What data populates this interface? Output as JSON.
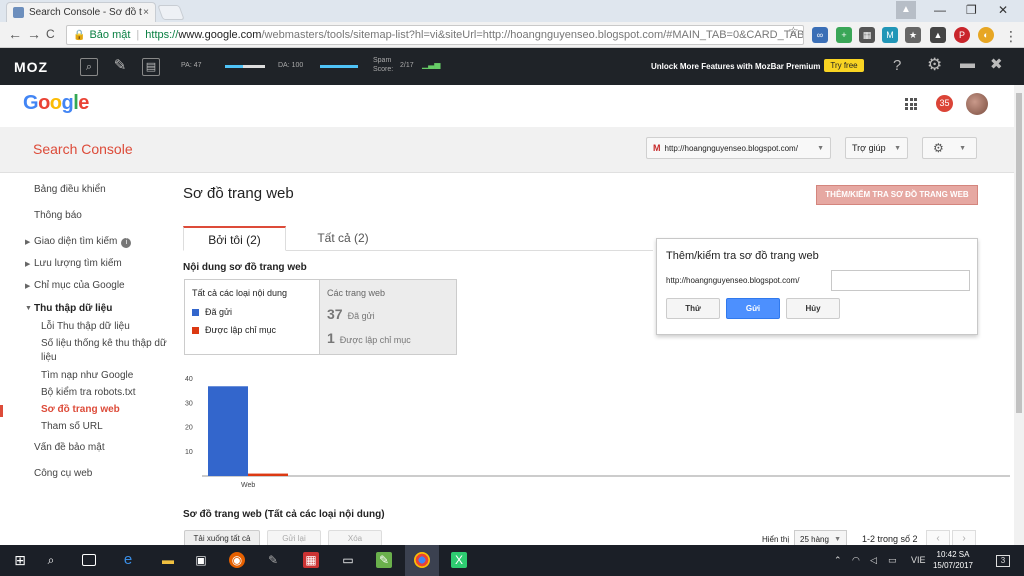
{
  "browser": {
    "tab_title": "Search Console - Sơ đồ t",
    "tab_close": "×",
    "profile_icon": "person-icon",
    "window_controls": [
      "—",
      "❐",
      "✕"
    ],
    "nav": {
      "back": "←",
      "forward": "→",
      "reload": "C"
    },
    "secure_label": "Bảo mật",
    "url_proto": "https://",
    "url_host": "www.google.com",
    "url_rest": "/webmasters/tools/sitemap-list?hl=vi&siteUrl=http://hoangnguyenseo.blogspot.com/#MAIN_TAB=0&CARD_TAB=",
    "star": "☆"
  },
  "mozbar": {
    "logo": "MOZ",
    "pa_label": "PA: 47",
    "da_label": "DA: 100",
    "spam_label_1": "Spam",
    "spam_label_2": "Score:",
    "spam_value": "2/17",
    "unlock_text": "Unlock More Features with MozBar Premium",
    "try_free": "Try free",
    "help": "?",
    "settings": "⚙"
  },
  "google": {
    "logo": [
      "G",
      "o",
      "o",
      "g",
      "l",
      "e"
    ],
    "logo_colors": [
      "#4285f4",
      "#ea4335",
      "#fbbc05",
      "#4285f4",
      "#34a853",
      "#ea4335"
    ],
    "notif_count": "35"
  },
  "console": {
    "title": "Search Console",
    "property": "http://hoangnguyenseo.blogspot.com/",
    "property_prefix": "M",
    "help_label": "Trợ giúp",
    "settings_icon": "⚙"
  },
  "sidebar": {
    "items": [
      {
        "label": "Bảng điều khiển"
      },
      {
        "label": "Thông báo"
      },
      {
        "label": "Giao diện tìm kiếm"
      },
      {
        "label": "Lưu lượng tìm kiếm"
      },
      {
        "label": "Chỉ mục của Google"
      },
      {
        "label": "Thu thập dữ liệu"
      },
      {
        "label": "Lỗi Thu thập dữ liệu"
      },
      {
        "label": "Số liệu thống kê thu thập dữ"
      },
      {
        "label": "liệu"
      },
      {
        "label": "Tìm nạp như Google"
      },
      {
        "label": "Bộ kiểm tra robots.txt"
      },
      {
        "label": "Sơ đồ trang web"
      },
      {
        "label": "Tham số URL"
      },
      {
        "label": "Vấn đề bảo mật"
      },
      {
        "label": "Công cụ web"
      }
    ],
    "info_glyph": "i"
  },
  "main": {
    "page_title": "Sơ đồ trang web",
    "add_test_button": "THÊM/KIỂM TRA SƠ ĐỒ TRANG WEB",
    "tabs": [
      {
        "label": "Bởi tôi (2)"
      },
      {
        "label": "Tất cả (2)"
      }
    ],
    "section_label": "Nội dung sơ đồ trang web",
    "legend": {
      "header": "Tất cả các loại nội dung",
      "submitted": "Đã gửi",
      "indexed": "Được lập chỉ mục"
    },
    "stats": {
      "header": "Các trang web",
      "submitted_value": "37",
      "submitted_label": "Đã gửi",
      "indexed_value": "1",
      "indexed_label": "Được lập chỉ mục"
    },
    "sitemap_label": "Sơ đồ trang web (Tất cả các loại nội dung)",
    "toolbar": {
      "download": "Tải xuống tất cả",
      "resubmit": "Gửi lại",
      "delete": "Xóa"
    },
    "show_label": "Hiển thị",
    "rows_value": "25 hàng",
    "page_info": "1-2 trong số 2",
    "prev": "‹",
    "next": "›"
  },
  "popup": {
    "title": "Thêm/kiểm tra sơ đồ trang web",
    "prefix": "http://hoangnguyenseo.blogspot.com/",
    "input_value": "",
    "test_button": "Thử",
    "submit_button": "Gửi",
    "cancel_button": "Hủy"
  },
  "chart_data": {
    "type": "bar",
    "categories": [
      "Web"
    ],
    "series": [
      {
        "name": "Đã gửi",
        "values": [
          37
        ],
        "color": "#3366cc"
      },
      {
        "name": "Được lập chỉ mục",
        "values": [
          1
        ],
        "color": "#dc3912"
      }
    ],
    "yticks": [
      10,
      20,
      30,
      40
    ],
    "ylim": [
      0,
      40
    ],
    "grid": false,
    "legend": "left"
  },
  "taskbar": {
    "tray_lang": "VIE",
    "time": "10:42 SA",
    "date": "15/07/2017",
    "notif": "3"
  }
}
